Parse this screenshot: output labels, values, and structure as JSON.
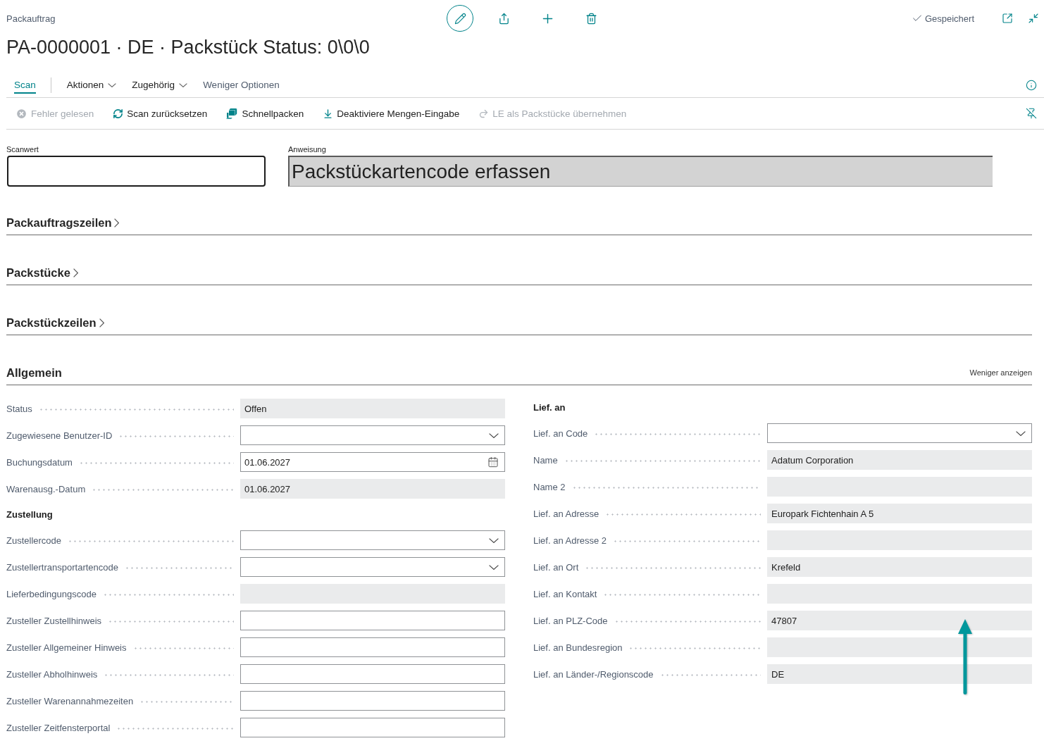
{
  "header": {
    "breadcrumb": "Packauftrag",
    "title": "PA-0000001 · DE · Packstück Status: 0\\0\\0",
    "save_status": "Gespeichert"
  },
  "tabs": [
    {
      "label": "Scan",
      "kind": "tab",
      "selected": true
    },
    {
      "label": "Aktionen",
      "kind": "menu",
      "selected": false
    },
    {
      "label": "Zugehörig",
      "kind": "menu",
      "selected": false
    },
    {
      "label": "Weniger Optionen",
      "kind": "link",
      "selected": false
    }
  ],
  "actions": [
    {
      "label": "Fehler gelesen",
      "disabled": true
    },
    {
      "label": "Scan zurücksetzen",
      "disabled": false
    },
    {
      "label": "Schnellpacken",
      "disabled": false
    },
    {
      "label": "Deaktiviere Mengen-Eingabe",
      "disabled": false
    },
    {
      "label": "LE als Packstücke übernehmen",
      "disabled": true
    }
  ],
  "scan": {
    "label": "Scanwert"
  },
  "instruction": {
    "label": "Anweisung",
    "value": "Packstückartencode erfassen"
  },
  "sections": [
    {
      "title": "Packauftragszeilen",
      "expanded": false
    },
    {
      "title": "Packstücke",
      "expanded": false
    },
    {
      "title": "Packstückzeilen",
      "expanded": false
    }
  ],
  "general": {
    "title": "Allgemein",
    "toggle": "Weniger anzeigen",
    "columns": [
      [
        {
          "kind": "readonly",
          "label": "Status",
          "value": "Offen"
        },
        {
          "kind": "dropdown",
          "label": "Zugewiesene Benutzer-ID"
        },
        {
          "kind": "date",
          "label": "Buchungsdatum",
          "value": "01.06.2027"
        },
        {
          "kind": "readonly",
          "label": "Warenausg.-Datum",
          "value": "01.06.2027"
        },
        {
          "kind": "heading",
          "label": "Zustellung"
        },
        {
          "kind": "dropdown",
          "label": "Zustellercode"
        },
        {
          "kind": "dropdown",
          "label": "Zustellertransportartencode"
        },
        {
          "kind": "readonly",
          "label": "Lieferbedingungscode"
        },
        {
          "kind": "text",
          "label": "Zusteller Zustellhinweis"
        },
        {
          "kind": "text",
          "label": "Zusteller Allgemeiner Hinweis"
        },
        {
          "kind": "text",
          "label": "Zusteller Abholhinweis"
        },
        {
          "kind": "text",
          "label": "Zusteller Warenannahmezeiten"
        },
        {
          "kind": "text",
          "label": "Zusteller Zeitfensterportal"
        }
      ],
      [
        {
          "kind": "heading",
          "label": "Lief. an"
        },
        {
          "kind": "dropdown",
          "label": "Lief. an Code"
        },
        {
          "kind": "readonly",
          "label": "Name",
          "value": "Adatum Corporation"
        },
        {
          "kind": "readonly",
          "label": "Name 2"
        },
        {
          "kind": "readonly",
          "label": "Lief. an Adresse",
          "value": "Europark Fichtenhain A 5"
        },
        {
          "kind": "readonly",
          "label": "Lief. an Adresse 2"
        },
        {
          "kind": "readonly",
          "label": "Lief. an Ort",
          "value": "Krefeld"
        },
        {
          "kind": "readonly",
          "label": "Lief. an Kontakt"
        },
        {
          "kind": "readonly",
          "label": "Lief. an PLZ-Code",
          "value": "47807"
        },
        {
          "kind": "readonly",
          "label": "Lief. an Bundesregion"
        },
        {
          "kind": "readonly",
          "label": "Lief. an Länder-/Regionscode",
          "value": "DE"
        }
      ]
    ]
  }
}
